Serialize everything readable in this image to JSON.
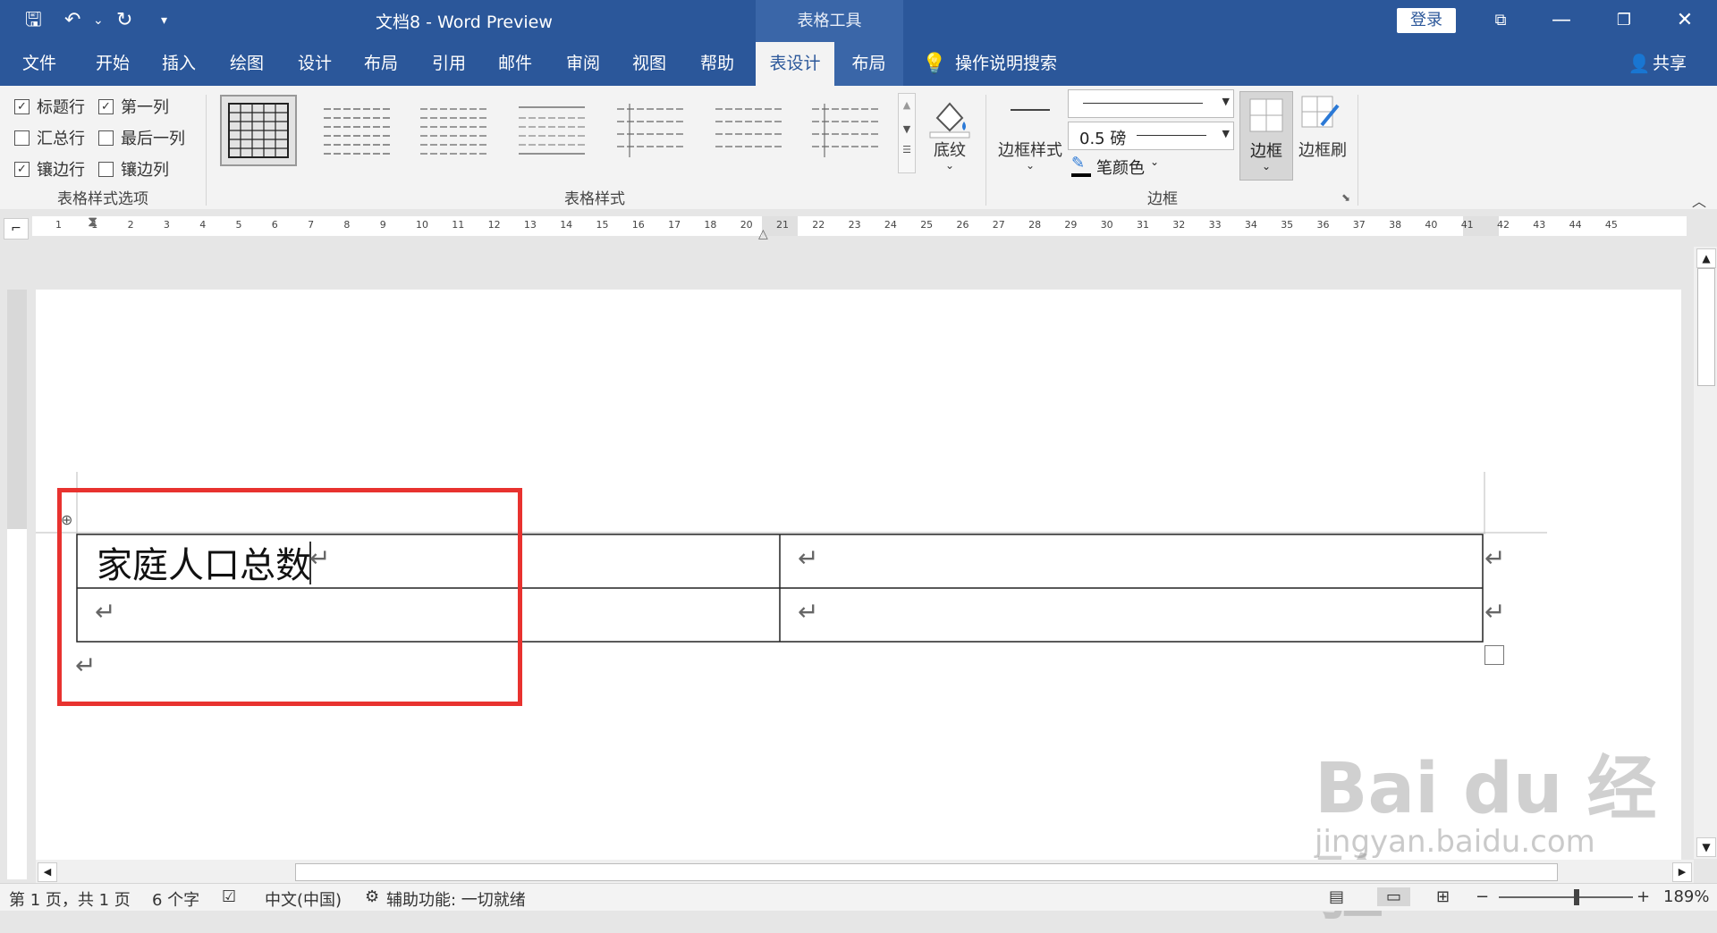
{
  "titlebar": {
    "doc_title": "文档8  -  Word Preview",
    "context_tool": "表格工具",
    "login_label": "登录",
    "save_icon": "save-icon",
    "undo_icon": "undo-icon",
    "redo_icon": "redo-icon"
  },
  "tabs": [
    {
      "label": "文件"
    },
    {
      "label": "开始"
    },
    {
      "label": "插入"
    },
    {
      "label": "绘图"
    },
    {
      "label": "设计"
    },
    {
      "label": "布局"
    },
    {
      "label": "引用"
    },
    {
      "label": "邮件"
    },
    {
      "label": "审阅"
    },
    {
      "label": "视图"
    },
    {
      "label": "帮助"
    },
    {
      "label": "表设计"
    },
    {
      "label": "布局"
    }
  ],
  "search_tell": "操作说明搜索",
  "share_label": "共享",
  "ribbon": {
    "style_options": {
      "label": "表格样式选项",
      "items": [
        {
          "label": "标题行",
          "checked": true
        },
        {
          "label": "第一列",
          "checked": true
        },
        {
          "label": "汇总行",
          "checked": false
        },
        {
          "label": "最后一列",
          "checked": false
        },
        {
          "label": "镶边行",
          "checked": true
        },
        {
          "label": "镶边列",
          "checked": false
        }
      ]
    },
    "table_styles_label": "表格样式",
    "shading_label": "底纹",
    "border_styles_label": "边框样式",
    "pen_weight": "0.5 磅",
    "pen_color_label": "笔颜色",
    "borders_label": "边框",
    "border_painter_label": "边框刷",
    "borders_group_label": "边框"
  },
  "ruler_numbers": [
    "1",
    "1",
    "2",
    "3",
    "4",
    "5",
    "6",
    "7",
    "8",
    "9",
    "10",
    "11",
    "12",
    "13",
    "14",
    "15",
    "16",
    "17",
    "18",
    "20",
    "21",
    "22",
    "23",
    "24",
    "25",
    "26",
    "27",
    "28",
    "29",
    "30",
    "31",
    "32",
    "33",
    "34",
    "35",
    "36",
    "37",
    "38",
    "40",
    "41",
    "42",
    "43",
    "44",
    "45"
  ],
  "table": {
    "cell_1_1": "家庭人口总数",
    "pilcrow": "↵"
  },
  "status": {
    "page": "第 1 页，共 1 页",
    "words": "6 个字",
    "language": "中文(中国)",
    "accessibility": "辅助功能: 一切就绪",
    "zoom": "189%"
  },
  "watermark": {
    "main": "Bai du 经验",
    "sub": "jingyan.baidu.com"
  }
}
